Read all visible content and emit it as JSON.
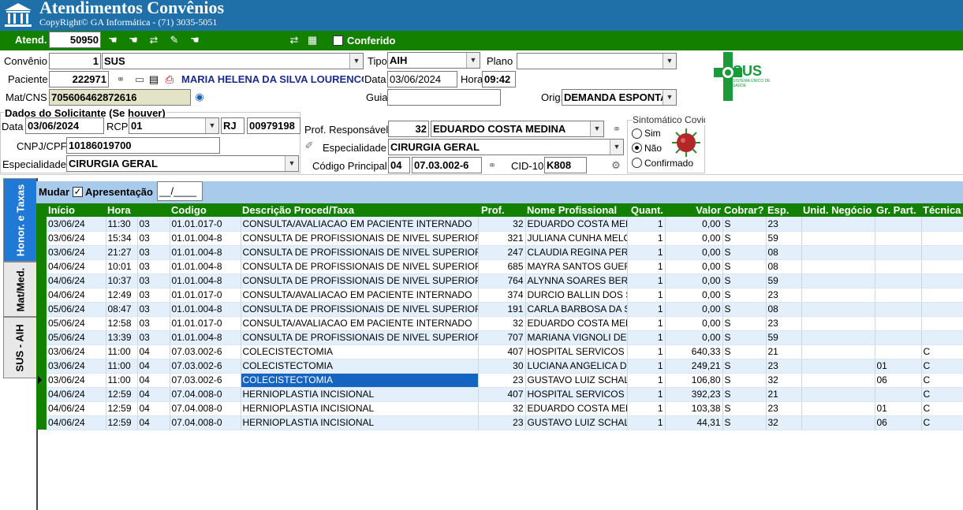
{
  "app": {
    "title": "Atendimentos Convênios",
    "copyright": "CopyRight© GA Informática - (71) 3035-5051"
  },
  "toolbar": {
    "atend_label": "Atend.",
    "atend_value": "50950",
    "conferido_label": "Conferido",
    "conferido_checked": false
  },
  "form": {
    "convenio": {
      "label": "Convênio",
      "code": "1",
      "name": "SUS"
    },
    "tipo": {
      "label": "Tipo",
      "value": "AIH"
    },
    "plano": {
      "label": "Plano",
      "value": ""
    },
    "paciente": {
      "label": "Paciente",
      "code": "222971",
      "name": "MARIA HELENA DA SILVA LOURENCO"
    },
    "data": {
      "label": "Data",
      "value": "03/06/2024"
    },
    "hora": {
      "label": "Hora",
      "value": "09:42"
    },
    "matcns": {
      "label": "Mat/CNS",
      "value": "705606462872616"
    },
    "guia": {
      "label": "Guia",
      "value": ""
    },
    "orig": {
      "label": "Orig.",
      "value": "DEMANDA ESPONTANEA"
    }
  },
  "solicitante": {
    "title": "Dados do Solicitante (Se houver)",
    "data_label": "Data",
    "data_value": "03/06/2024",
    "rcp_label": "RCP",
    "rcp_value": "01",
    "uf": "RJ",
    "crm": "00979198",
    "cnpj_label": "CNPJ/CPF",
    "cnpj_value": "10186019700",
    "esp_label": "Especialidade",
    "esp_value": "CIRURGIA GERAL"
  },
  "responsavel": {
    "prof_label": "Prof. Responsável",
    "prof_code": "32",
    "prof_name": "EDUARDO COSTA MEDINA",
    "esp_label": "Especialidade",
    "esp_value": "CIRURGIA GERAL",
    "codigo_label": "Código Principal",
    "codigo_a": "04",
    "codigo_b": "07.03.002-6",
    "cid_label": "CID-10",
    "cid_value": "K808"
  },
  "covid": {
    "title": "Sintomático Covid",
    "options": [
      "Sim",
      "Não",
      "Confirmado"
    ],
    "selected": "Não"
  },
  "sus_logo": {
    "text": "SUS",
    "subtext": "SISTEMA ÚNICO DE SAÚDE",
    "color": "#1a9a3a"
  },
  "tabs": [
    {
      "label": "Honor. e Taxas",
      "active": true
    },
    {
      "label": "Mat/Med.",
      "active": false
    },
    {
      "label": "SUS - AIH",
      "active": false
    }
  ],
  "panel": {
    "mudar_label": "Mudar",
    "apresentacao_label": "Apresentação",
    "apresentacao_checked": true,
    "apresentacao_value": "__/____"
  },
  "columns": [
    "Início",
    "Hora",
    "",
    "Codigo",
    "Descrição Proced/Taxa",
    "Prof.",
    "Nome Profissional",
    "Quant.",
    "Valor",
    "Cobrar?",
    "Esp.",
    "Unid. Negócio",
    "Gr. Part.",
    "Técnica"
  ],
  "rows": [
    [
      "03/06/24",
      "11:30",
      "03",
      "01.01.017-0",
      "CONSULTA/AVALIACAO EM PACIENTE INTERNADO",
      "32",
      "EDUARDO COSTA MEDINA",
      "1",
      "0,00",
      "S",
      "23",
      "",
      "",
      ""
    ],
    [
      "03/06/24",
      "15:34",
      "03",
      "01.01.004-8",
      "CONSULTA DE PROFISSIONAIS DE NIVEL SUPERIOR",
      "321",
      "JULIANA CUNHA MELO",
      "1",
      "0,00",
      "S",
      "59",
      "",
      "",
      ""
    ],
    [
      "03/06/24",
      "21:27",
      "03",
      "01.01.004-8",
      "CONSULTA DE PROFISSIONAIS DE NIVEL SUPERIOR",
      "247",
      "CLAUDIA REGINA PEREIRA",
      "1",
      "0,00",
      "S",
      "08",
      "",
      "",
      ""
    ],
    [
      "04/06/24",
      "10:01",
      "03",
      "01.01.004-8",
      "CONSULTA DE PROFISSIONAIS DE NIVEL SUPERIOR",
      "685",
      "MAYRA SANTOS GUERRA",
      "1",
      "0,00",
      "S",
      "08",
      "",
      "",
      ""
    ],
    [
      "04/06/24",
      "10:37",
      "03",
      "01.01.004-8",
      "CONSULTA DE PROFISSIONAIS DE NIVEL SUPERIOR",
      "764",
      "ALYNNA SOARES BERNARDES",
      "1",
      "0,00",
      "S",
      "59",
      "",
      "",
      ""
    ],
    [
      "04/06/24",
      "12:49",
      "03",
      "01.01.017-0",
      "CONSULTA/AVALIACAO EM PACIENTE INTERNADO",
      "374",
      "DURCIO BALLIN DOS SANTOS",
      "1",
      "0,00",
      "S",
      "23",
      "",
      "",
      ""
    ],
    [
      "05/06/24",
      "08:47",
      "03",
      "01.01.004-8",
      "CONSULTA DE PROFISSIONAIS DE NIVEL SUPERIOR",
      "191",
      "CARLA BARBOSA DA SILVA",
      "1",
      "0,00",
      "S",
      "08",
      "",
      "",
      ""
    ],
    [
      "05/06/24",
      "12:58",
      "03",
      "01.01.017-0",
      "CONSULTA/AVALIACAO EM PACIENTE INTERNADO",
      "32",
      "EDUARDO COSTA MEDINA",
      "1",
      "0,00",
      "S",
      "23",
      "",
      "",
      ""
    ],
    [
      "05/06/24",
      "13:39",
      "03",
      "01.01.004-8",
      "CONSULTA DE PROFISSIONAIS DE NIVEL SUPERIOR",
      "707",
      "MARIANA VIGNOLI DE SOUZA",
      "1",
      "0,00",
      "S",
      "59",
      "",
      "",
      ""
    ],
    [
      "03/06/24",
      "11:00",
      "04",
      "07.03.002-6",
      "COLECISTECTOMIA",
      "407",
      "HOSPITAL SERVICOS",
      "1",
      "640,33",
      "S",
      "21",
      "",
      "",
      "C"
    ],
    [
      "03/06/24",
      "11:00",
      "04",
      "07.03.002-6",
      "COLECISTECTOMIA",
      "30",
      "LUCIANA ANGELICA DIAS",
      "1",
      "249,21",
      "S",
      "23",
      "",
      "01",
      "C"
    ],
    [
      "03/06/24",
      "11:00",
      "04",
      "07.03.002-6",
      "COLECISTECTOMIA",
      "23",
      "GUSTAVO LUIZ SCHALL",
      "1",
      "106,80",
      "S",
      "32",
      "",
      "06",
      "C"
    ],
    [
      "04/06/24",
      "12:59",
      "04",
      "07.04.008-0",
      "HERNIOPLASTIA INCISIONAL",
      "407",
      "HOSPITAL SERVICOS",
      "1",
      "392,23",
      "S",
      "21",
      "",
      "",
      "C"
    ],
    [
      "04/06/24",
      "12:59",
      "04",
      "07.04.008-0",
      "HERNIOPLASTIA INCISIONAL",
      "32",
      "EDUARDO COSTA MEDINA",
      "1",
      "103,38",
      "S",
      "23",
      "",
      "01",
      "C"
    ],
    [
      "04/06/24",
      "12:59",
      "04",
      "07.04.008-0",
      "HERNIOPLASTIA INCISIONAL",
      "23",
      "GUSTAVO LUIZ SCHALL",
      "1",
      "44,31",
      "S",
      "32",
      "",
      "06",
      "C"
    ]
  ],
  "selected_row": 11,
  "colors": {
    "title_bar": "#1f6fa8",
    "green_bar": "#138000",
    "grid_header": "#138000",
    "selection": "#1565c0",
    "tab_active": "#1e7ad6",
    "panel_bar": "#a9cbeb"
  }
}
